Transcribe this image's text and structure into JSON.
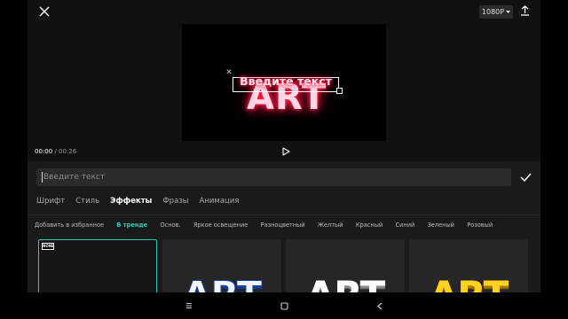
{
  "header": {
    "resolution": "1080P"
  },
  "preview": {
    "art_text": "ART",
    "overlay_text": "Введите текст",
    "time_current": "00:00",
    "time_separator": " / ",
    "time_total": "00:26"
  },
  "editor": {
    "input_placeholder": "Введите текст"
  },
  "tabs": [
    {
      "label": "Шрифт"
    },
    {
      "label": "Стиль"
    },
    {
      "label": "Эффекты",
      "active": true
    },
    {
      "label": "Фразы"
    },
    {
      "label": "Анимация"
    }
  ],
  "categories": [
    {
      "label": "Добавить в избранное"
    },
    {
      "label": "В тренде",
      "active": true
    },
    {
      "label": "Основ."
    },
    {
      "label": "Яркое освещение"
    },
    {
      "label": "Разноцветный"
    },
    {
      "label": "Желтый"
    },
    {
      "label": "Красный"
    },
    {
      "label": "Синий"
    },
    {
      "label": "Зеленый"
    },
    {
      "label": "Розовый"
    }
  ],
  "presets": [
    {
      "label": "NONE",
      "kind": "none",
      "selected": true
    },
    {
      "art": "ART",
      "style": "blue-chrome"
    },
    {
      "art": "ART",
      "style": "silver"
    },
    {
      "art": "ART",
      "style": "gold"
    }
  ],
  "colors": {
    "accent": "#37c4bd",
    "neon": "#ff1a44"
  }
}
